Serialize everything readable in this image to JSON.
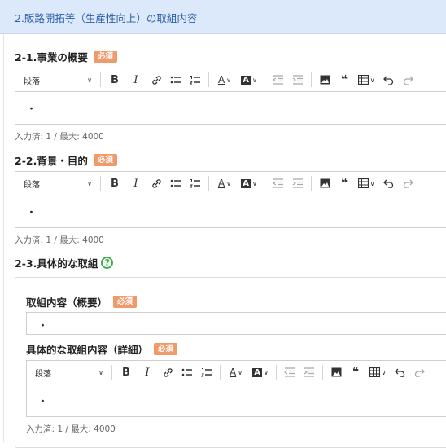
{
  "section_title": "2.販路開拓等（生産性向上）の取組内容",
  "required_badge": "必須",
  "help_icon": "?",
  "fields": [
    {
      "label": "2-1.事業の概要",
      "required": true,
      "content": "・",
      "counter": "入力済: 1 / 最大: 4000"
    },
    {
      "label": "2-2.背景・目的",
      "required": true,
      "content": "・",
      "counter": "入力済: 1 / 最大: 4000"
    }
  ],
  "subsection": {
    "label": "2-3.具体的な取組",
    "summary": {
      "label": "取組内容（概要）",
      "required": true,
      "value": "・"
    },
    "detail": {
      "label": "具体的な取組内容（詳細）",
      "required": true,
      "content": "・",
      "counter": "入力済: 1 / 最大: 4000"
    }
  },
  "toolbar": {
    "paragraph": "段落",
    "icons": [
      "bold-icon",
      "italic-icon",
      "link-icon",
      "bulleted-list-icon",
      "numbered-list-icon",
      "font-color-icon",
      "highlight-icon",
      "outdent-icon",
      "indent-icon",
      "image-icon",
      "blockquote-icon",
      "table-icon",
      "undo-icon",
      "redo-icon"
    ]
  },
  "colors": {
    "header_bg": "#dce9fb",
    "header_text": "#2a5ea8",
    "badge": "#f09a6c",
    "help": "#3fae49"
  }
}
